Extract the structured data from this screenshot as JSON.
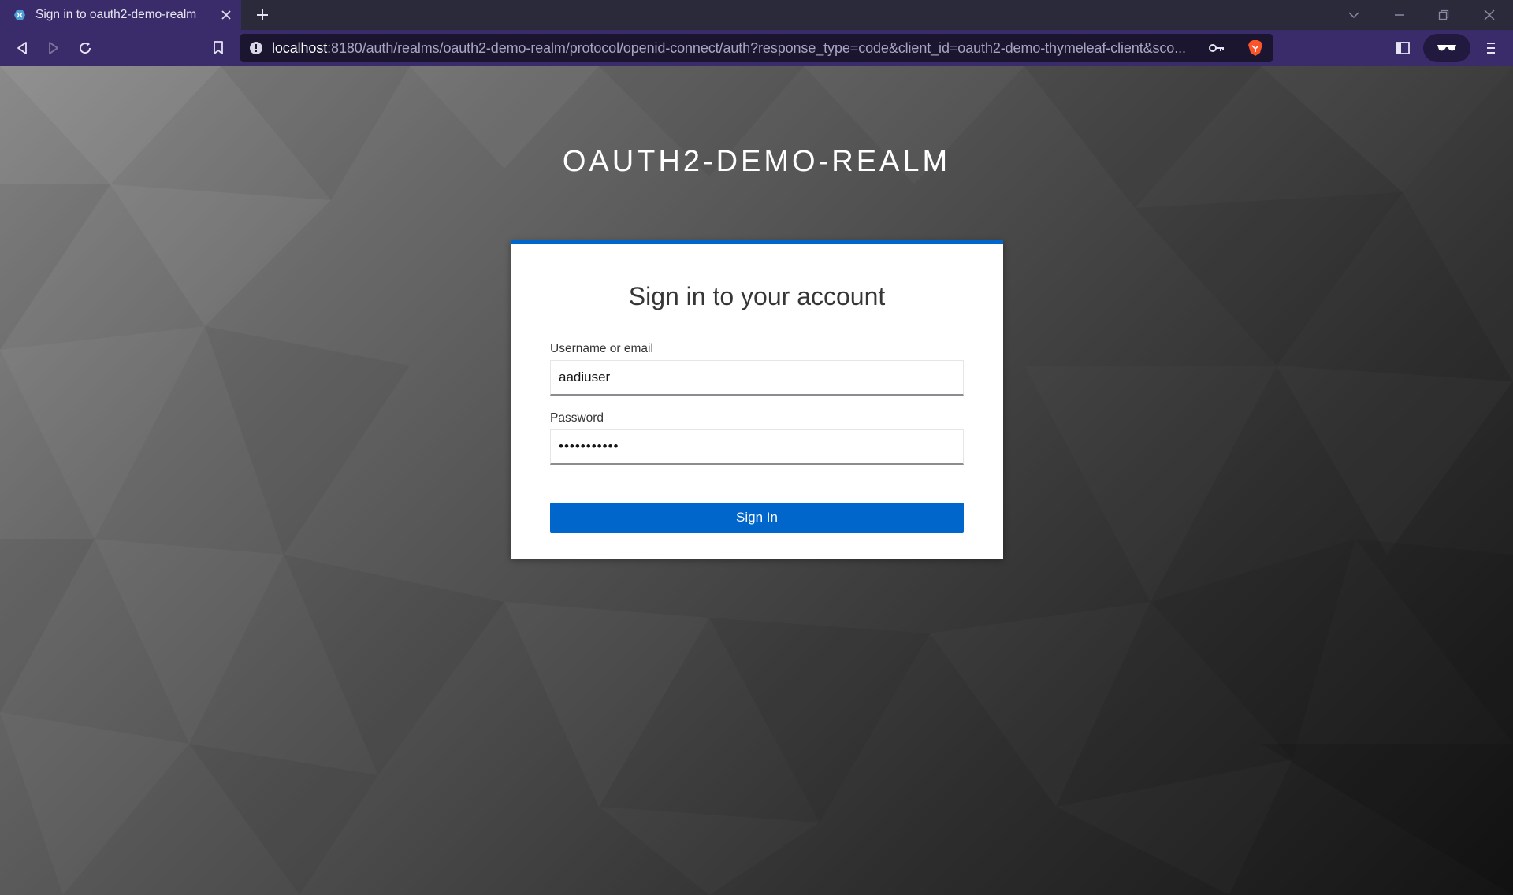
{
  "browser": {
    "tab": {
      "title": "Sign in to oauth2-demo-realm",
      "favicon": "keycloak-favicon"
    },
    "url": {
      "host": "localhost",
      "rest": ":8180/auth/realms/oauth2-demo-realm/protocol/openid-connect/auth?response_type=code&client_id=oauth2-demo-thymeleaf-client&sco..."
    }
  },
  "page": {
    "realm_header": "OAUTH2-DEMO-REALM",
    "card_title": "Sign in to your account",
    "username": {
      "label": "Username or email",
      "value": "aadiuser"
    },
    "password": {
      "label": "Password",
      "masked_value": "•••••••••••"
    },
    "submit_label": "Sign In"
  },
  "colors": {
    "chrome": "#3a2b6b",
    "accent": "#0066cc",
    "brave_orange": "#fb542b"
  }
}
